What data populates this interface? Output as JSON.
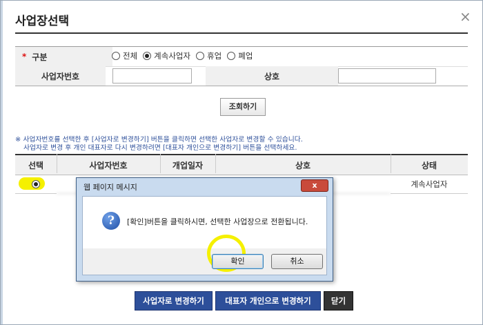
{
  "dialog": {
    "title": "사업장선택",
    "close_glyph": "×"
  },
  "form": {
    "category_label": "구분",
    "required_mark": "*",
    "options": [
      "전체",
      "계속사업자",
      "휴업",
      "폐업"
    ],
    "selected_option": "계속사업자",
    "biz_no_label": "사업자번호",
    "biz_no_value": "",
    "trade_name_label": "상호",
    "trade_name_value": "",
    "search_button": "조회하기"
  },
  "notes": [
    "※ 사업자번호를 선택한 후 [사업자로 변경하기] 버튼을 클릭하면 선택한 사업자로 변경할 수 있습니다.",
    "사업자로 변경 후 개인 대표자로 다시 변경하려면 [대표자 개인으로 변경하기] 버튼을 선택하세요."
  ],
  "table": {
    "headers": [
      "선택",
      "사업자번호",
      "개업일자",
      "상호",
      "상태"
    ],
    "rows": [
      {
        "biz_no": "",
        "open_date": "",
        "trade_name": "",
        "status": "계속사업자"
      }
    ]
  },
  "message_box": {
    "title": "웹 페이지 메시지",
    "message": "[확인]버튼을 클릭하시면, 선택한 사업장으로 전환됩니다.",
    "ok": "확인",
    "cancel": "취소",
    "close_glyph": "x"
  },
  "actions": {
    "change_business": "사업자로 변경하기",
    "change_personal": "대표자 개인으로 변경하기",
    "close": "닫기"
  },
  "colors": {
    "primary_button": "#2d4f9a",
    "note_text": "#2d4f9a",
    "highlight": "#f5f000",
    "required": "#dd1111"
  }
}
